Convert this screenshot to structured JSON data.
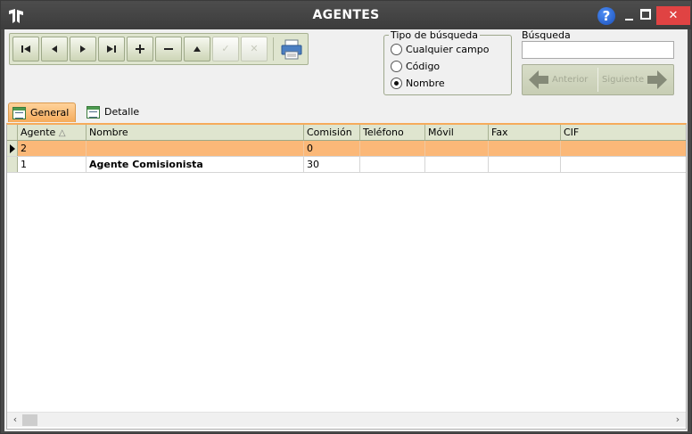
{
  "window": {
    "title": "AGENTES",
    "help_label": "?",
    "close_label": "✕"
  },
  "toolbar": {
    "first": "⏮",
    "prev": "◀",
    "next": "▶",
    "last": "⏭",
    "add": "+",
    "delete": "−",
    "up": "▲",
    "confirm": "✓",
    "cancel": "✕"
  },
  "search_type": {
    "legend": "Tipo de búsqueda",
    "options": [
      "Cualquier campo",
      "Código",
      "Nombre"
    ],
    "selected": "Nombre"
  },
  "search": {
    "label": "Búsqueda",
    "value": "",
    "prev_label": "Anterior",
    "next_label": "Siguiente"
  },
  "tabs": [
    {
      "label": "General",
      "active": true
    },
    {
      "label": "Detalle",
      "active": false
    }
  ],
  "grid": {
    "columns": [
      "Agente",
      "Nombre",
      "Comisión",
      "Teléfono",
      "Móvil",
      "Fax",
      "CIF"
    ],
    "sort_indicator": "△",
    "rows": [
      {
        "agente": "2",
        "nombre": "",
        "comision": "0",
        "telefono": "",
        "movil": "",
        "fax": "",
        "cif": "",
        "selected": true
      },
      {
        "agente": "1",
        "nombre": "Agente Comisionista",
        "comision": "30",
        "telefono": "",
        "movil": "",
        "fax": "",
        "cif": "",
        "selected": false
      }
    ]
  },
  "scrollbar": {
    "left": "‹",
    "right": "›"
  },
  "colors": {
    "titlebar": "#3c3c3c",
    "close": "#e04343",
    "selected_row": "#fbb878",
    "toolbar": "#dfe5cf",
    "help": "#1a4fb8"
  }
}
